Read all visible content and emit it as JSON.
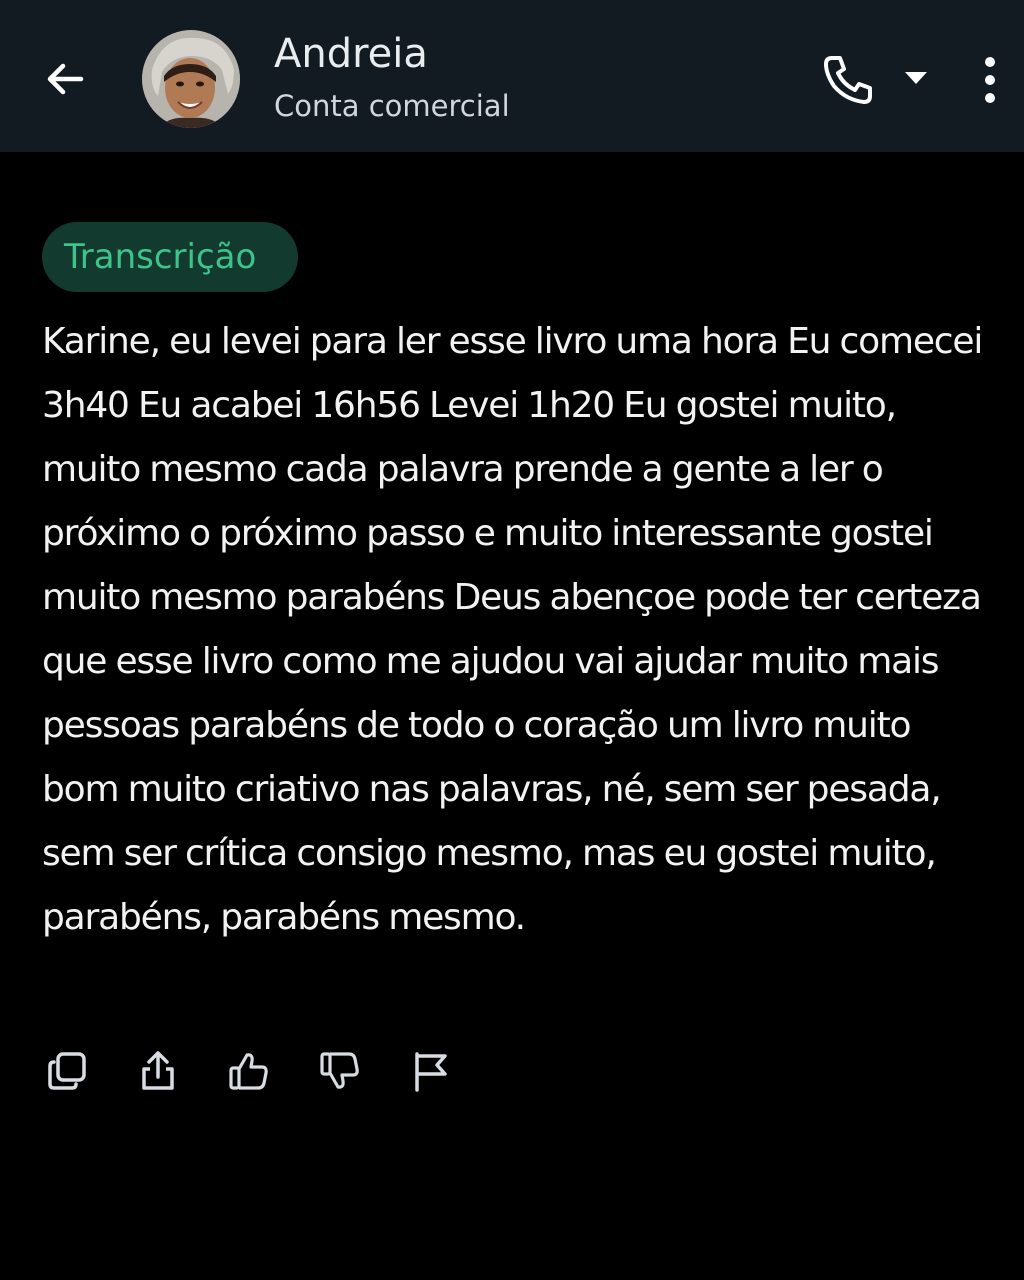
{
  "header": {
    "contact_name": "Andreia",
    "contact_subtitle": "Conta comercial",
    "icons": [
      "arrow-left",
      "avatar-photo",
      "phone",
      "caret-down",
      "more-vertical"
    ],
    "background": "#121b22"
  },
  "transcription": {
    "chip_label": "Transcrição",
    "chip_text_color": "#3ec38a",
    "chip_background": "#123a2f",
    "text": "Karine, eu levei para ler esse livro uma hora Eu comecei 3h40 Eu acabei 16h56 Levei 1h20 Eu gostei muito, muito mesmo cada palavra prende a gente a ler o próximo o próximo passo e muito interessante gostei muito mesmo parabéns Deus abençoe pode ter certeza que esse livro como me ajudou vai ajudar muito mais pessoas parabéns de todo o coração um livro muito bom muito criativo nas palavras, né, sem ser pesada, sem ser crítica consigo mesmo, mas eu gostei muito, parabéns, parabéns mesmo."
  },
  "actions": {
    "icons": [
      "copy",
      "share",
      "thumbs-up",
      "thumbs-down",
      "flag"
    ]
  },
  "theme": {
    "page_background": "#000000",
    "text_color": "#f2f2f2"
  }
}
